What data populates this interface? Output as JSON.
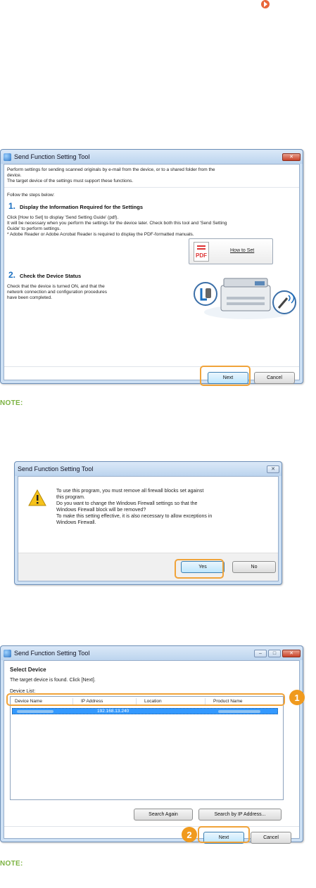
{
  "win1": {
    "title": "Send Function Setting Tool",
    "intro1": "Perform settings for sending scanned originals by e-mail from the device, or to a shared folder from the",
    "intro2": "device.",
    "intro3": "The target device of the settings must support these functions.",
    "follow": "Follow the steps below:",
    "step1_num": "1.",
    "step1_title": "Display the Information Required for the Settings",
    "s1l1": "Click [How to Set] to display 'Send Setting Guide' (pdf).",
    "s1l2": "It will be necessary when you perform the settings for the device later. Check both this tool and 'Send Setting",
    "s1l3": "Guide' to perform settings.",
    "s1l4": "* Adobe Reader or Adobe Acrobat Reader is required to display the PDF-formatted manuals.",
    "pdf_text": "PDF",
    "howto_label": "How to Set",
    "step2_num": "2.",
    "step2_title": "Check the Device Status",
    "s2l1": "Check that the device is turned ON, and that the",
    "s2l2": "network connection and configuration procedures",
    "s2l3": "have been completed.",
    "next_label": "Next",
    "cancel_label": "Cancel"
  },
  "note1": "NOTE:",
  "win2": {
    "title": "Send Function Setting Tool",
    "l1": "To use this program, you must remove all firewall blocks set against",
    "l2": "this program.",
    "l3": "Do you want to change the Windows Firewall settings so that the",
    "l4": "Windows Firewall block will be removed?",
    "l5": "To make this setting effective, it is also necessary to allow exceptions in",
    "l6": "Windows Firewall.",
    "yes_label": "Yes",
    "no_label": "No"
  },
  "win3": {
    "title": "Send Function Setting Tool",
    "heading": "Select Device",
    "sub": "The target device is found. Click [Next].",
    "list_label": "Device List:",
    "columns": [
      "Device Name",
      "IP Address",
      "Location",
      "Product Name"
    ],
    "row_ip": "192.168.13.240",
    "search_again": "Search Again",
    "search_ip": "Search by IP Address...",
    "next_label": "Next",
    "cancel_label": "Cancel",
    "badge1": "1",
    "badge2": "2"
  },
  "note2": "NOTE:",
  "accent": "#f0a33a",
  "note_color": "#7cb342"
}
